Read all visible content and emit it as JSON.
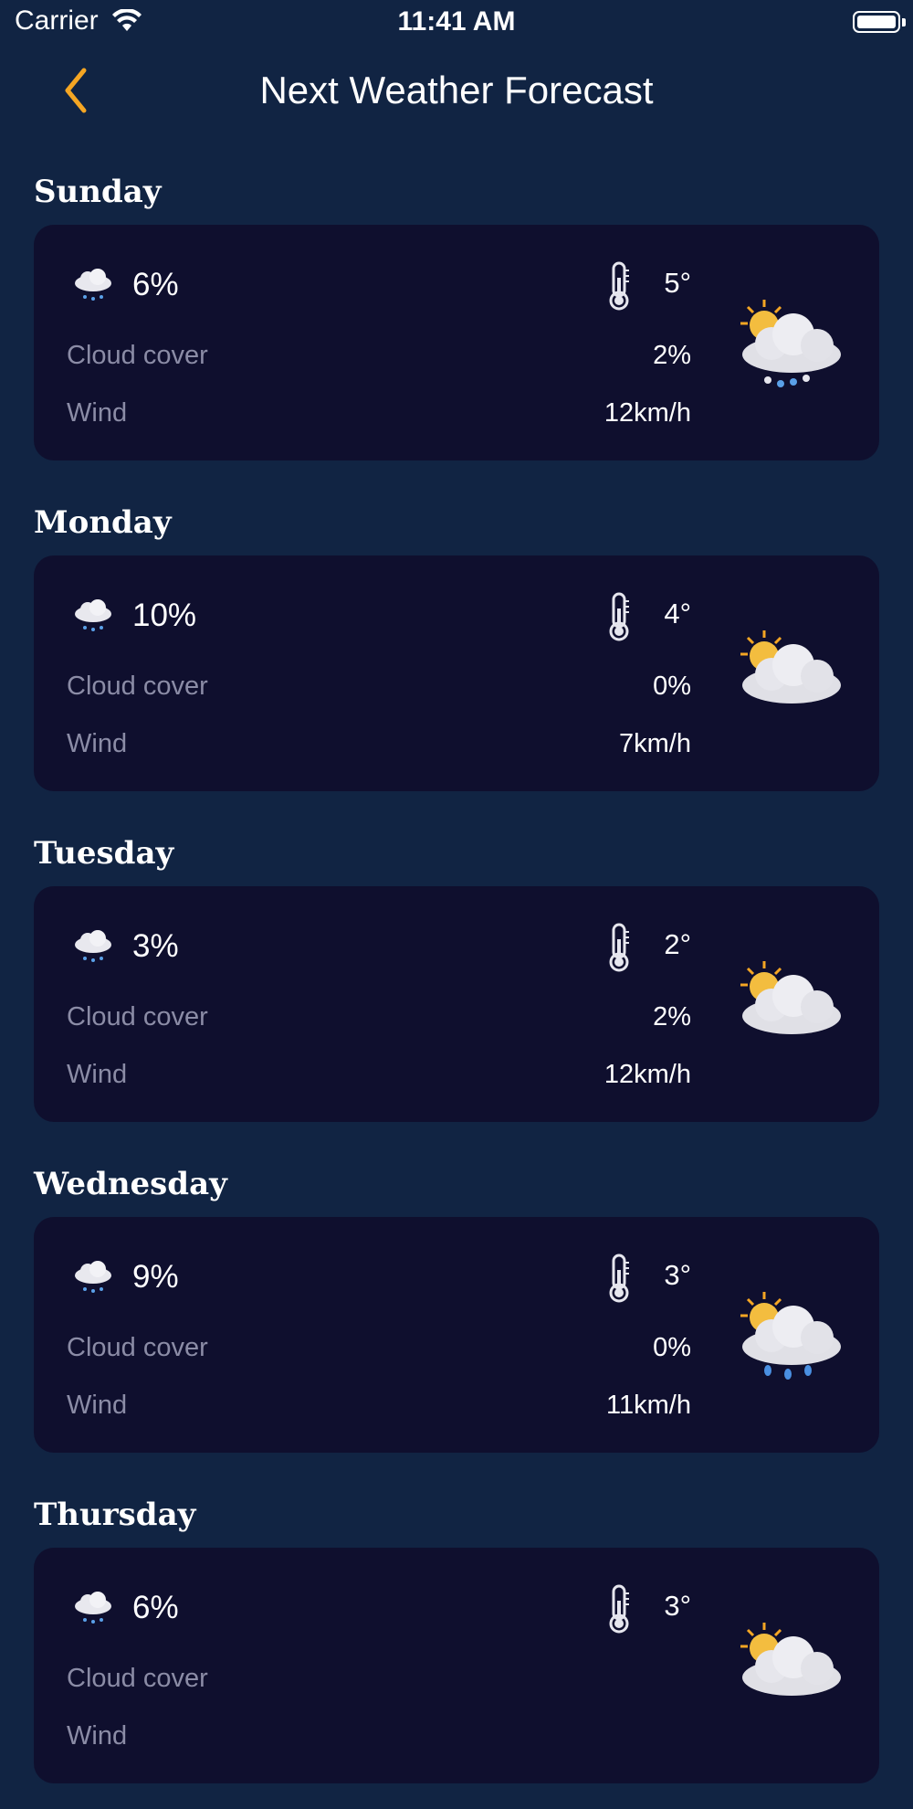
{
  "status_bar": {
    "carrier": "Carrier",
    "time": "11:41 AM"
  },
  "nav": {
    "title": "Next Weather Forecast"
  },
  "labels": {
    "cloud_cover": "Cloud cover",
    "wind": "Wind"
  },
  "days": [
    {
      "day": "Sunday",
      "precipitation": "6%",
      "temperature": "5°",
      "cloud_cover": "2%",
      "wind": "12km/h",
      "icon": "partly-cloudy-snow-icon"
    },
    {
      "day": "Monday",
      "precipitation": "10%",
      "temperature": "4°",
      "cloud_cover": "0%",
      "wind": "7km/h",
      "icon": "partly-cloudy-icon"
    },
    {
      "day": "Tuesday",
      "precipitation": "3%",
      "temperature": "2°",
      "cloud_cover": "2%",
      "wind": "12km/h",
      "icon": "partly-cloudy-icon"
    },
    {
      "day": "Wednesday",
      "precipitation": "9%",
      "temperature": "3°",
      "cloud_cover": "0%",
      "wind": "11km/h",
      "icon": "partly-cloudy-rain-icon"
    },
    {
      "day": "Thursday",
      "precipitation": "6%",
      "temperature": "3°",
      "cloud_cover": "",
      "wind": "",
      "icon": "partly-cloudy-icon"
    }
  ],
  "colors": {
    "background": "#112443",
    "card": "#0f0f2e",
    "accent": "#f5a623",
    "muted_text": "#8b8ca6"
  }
}
